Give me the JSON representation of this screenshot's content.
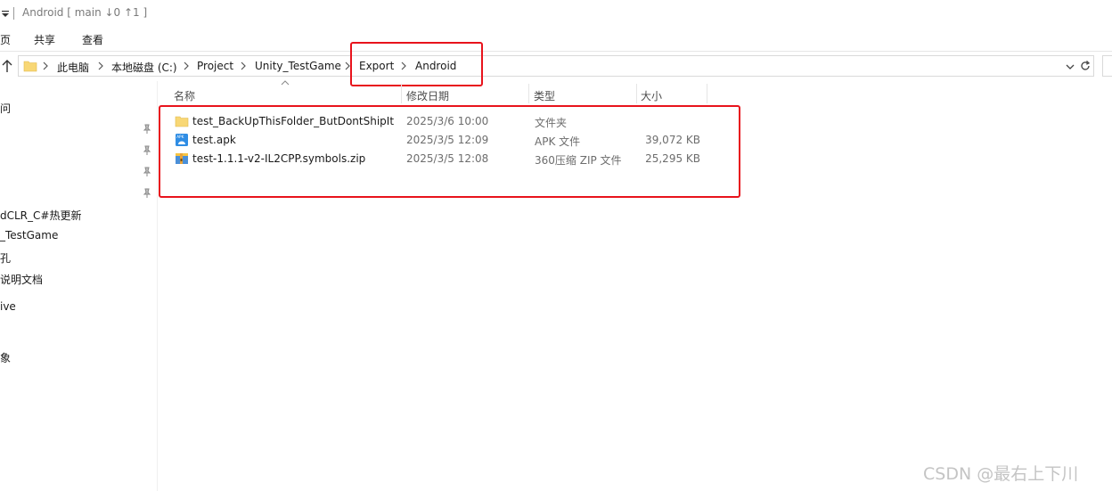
{
  "titlebar": {
    "title": "Android [ main ↓0 ↑1 ]"
  },
  "ribbon": {
    "tabs": [
      "页",
      "共享",
      "查看"
    ]
  },
  "address": {
    "crumbs": [
      "此电脑",
      "本地磁盘 (C:)",
      "Project",
      "Unity_TestGame",
      "Export",
      "Android"
    ]
  },
  "nav": {
    "items": [
      "问",
      "dCLR_C#热更新",
      "_TestGame",
      "孔",
      "说明文档",
      "ive",
      "象"
    ]
  },
  "columns": {
    "name": "名称",
    "date": "修改日期",
    "type": "类型",
    "size": "大小"
  },
  "files": [
    {
      "name": "test_BackUpThisFolder_ButDontShipItWithYourGame",
      "date": "2025/3/6 10:00",
      "type": "文件夹",
      "size": "",
      "icon": "folder-icon"
    },
    {
      "name": "test.apk",
      "date": "2025/3/5 12:09",
      "type": "APK 文件",
      "size": "39,072 KB",
      "icon": "apk-icon"
    },
    {
      "name": "test-1.1.1-v2-IL2CPP.symbols.zip",
      "date": "2025/3/5 12:08",
      "type": "360压缩 ZIP 文件",
      "size": "25,295 KB",
      "icon": "zip-icon"
    }
  ],
  "watermark": "CSDN @最右上下川",
  "colors": {
    "highlight": "#e8131c",
    "folder": "#f8d775"
  }
}
